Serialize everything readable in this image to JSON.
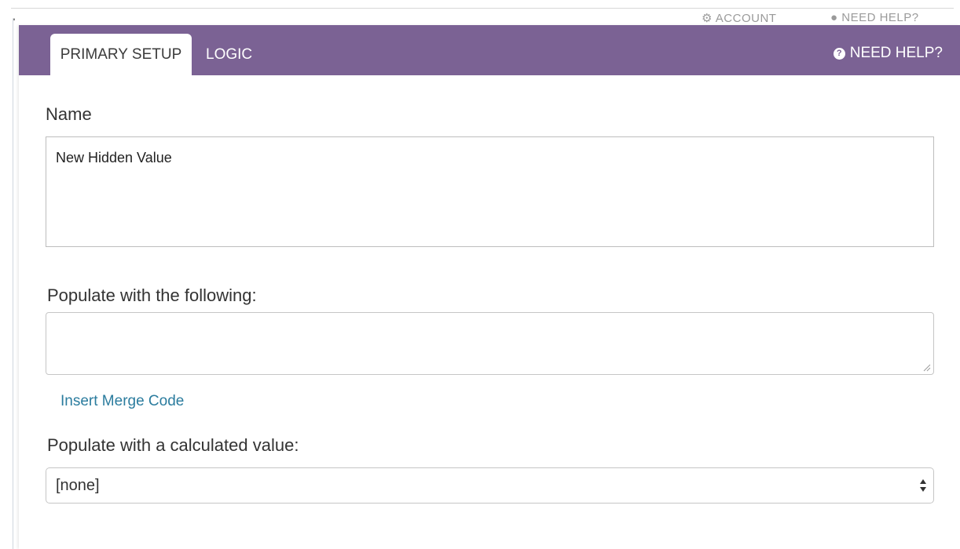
{
  "background": {
    "account_label": "ACCOUNT",
    "need_help_label": "NEED HELP?"
  },
  "header": {
    "tabs": [
      {
        "label": "PRIMARY SETUP",
        "active": true
      },
      {
        "label": "LOGIC",
        "active": false
      }
    ],
    "help_label": "NEED HELP?",
    "color": "#7b6294"
  },
  "form": {
    "name_label": "Name",
    "name_value": "New Hidden Value",
    "populate_label": "Populate with the following:",
    "populate_value": "",
    "merge_code_link": "Insert Merge Code",
    "calculated_label": "Populate with a calculated value:",
    "calculated_selected": "[none]"
  },
  "colors": {
    "link": "#2b7c9e"
  }
}
